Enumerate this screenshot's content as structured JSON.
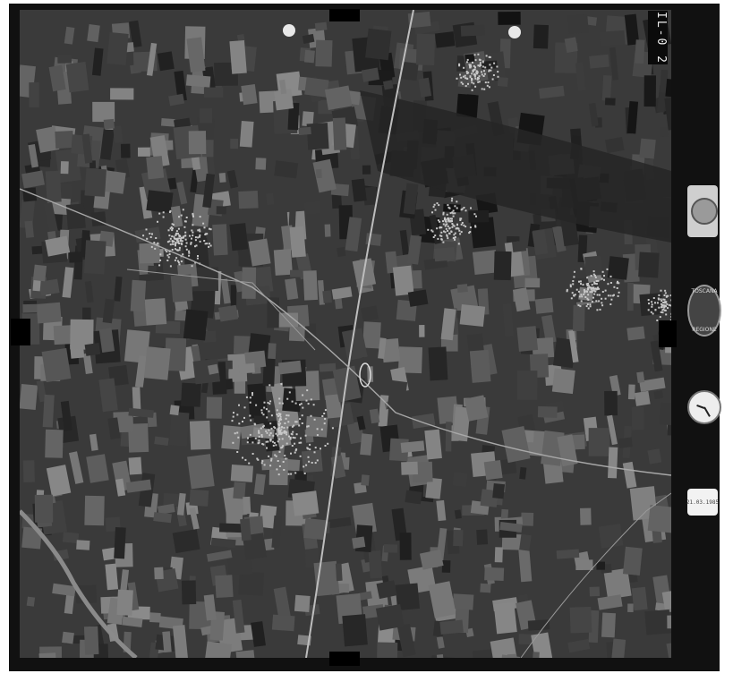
{
  "photo": {
    "frame_code": "IL-0 2",
    "description_tag": "aerial-photograph"
  },
  "side_instruments": {
    "level_top_label": "TOSCANA",
    "level_bottom_label": "REGIONE",
    "counter_value": "21.03.1985"
  },
  "colors": {
    "film_border": "#111111",
    "photo_base": "#3a3a3a",
    "fiducial": "#e8e8e8"
  }
}
